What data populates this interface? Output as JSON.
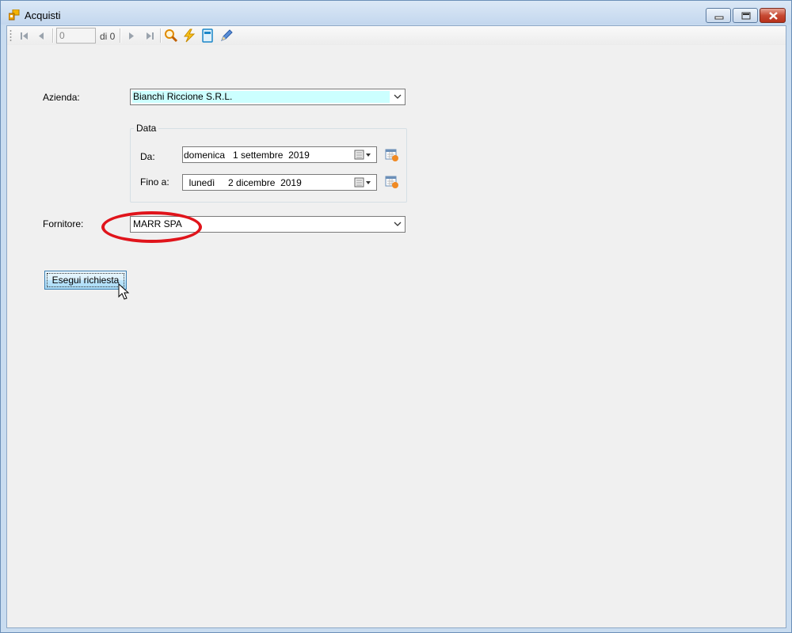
{
  "window": {
    "title": "Acquisti",
    "icon": "app-forms-icon"
  },
  "toolbar": {
    "position_value": "0",
    "count_label": "di 0",
    "icons": [
      "move-first-icon",
      "move-previous-icon",
      "move-next-icon",
      "move-last-icon",
      "search-icon",
      "lightning-icon",
      "document-icon",
      "pen-icon"
    ]
  },
  "form": {
    "azienda": {
      "label": "Azienda:",
      "value": "Bianchi Riccione S.R.L.",
      "highlight": "#ccffff"
    },
    "data_group": {
      "title": "Data",
      "da": {
        "label": "Da:",
        "value": "domenica   1 settembre  2019"
      },
      "fino_a": {
        "label": "Fino a:",
        "value": "  lunedì     2 dicembre  2019"
      }
    },
    "fornitore": {
      "label": "Fornitore:",
      "value": "MARR SPA"
    },
    "execute_button": "Esegui richiesta"
  },
  "colors": {
    "annotation_ellipse": "#e0141b",
    "form_background": "#f0f0f0",
    "window_frame": "#c9dcf0"
  }
}
